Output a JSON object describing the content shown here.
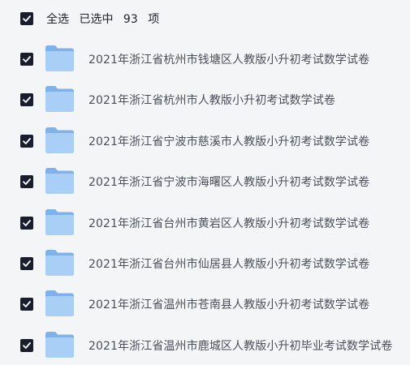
{
  "header": {
    "select_all": "全选",
    "selected_prefix": "已选中",
    "selected_count": "93",
    "selected_suffix": "项"
  },
  "files": [
    "2021年浙江省杭州市钱塘区人教版小升初考试数学试卷",
    "2021年浙江省杭州市人教版小升初考试数学试卷",
    "2021年浙江省宁波市慈溪市人教版小升初考试数学试卷",
    "2021年浙江省宁波市海曙区人教版小升初考试数学试卷",
    "2021年浙江省台州市黄岩区人教版小升初考试数学试卷",
    "2021年浙江省台州市仙居县人教版小升初考试数学试卷",
    "2021年浙江省温州市苍南县人教版小升初考试数学试卷",
    "2021年浙江省温州市鹿城区人教版小升初毕业考试数学试卷"
  ],
  "colors": {
    "checkbox": "#1a1d2e",
    "folder_back": "#7fb2ea",
    "folder_front": "#a9cff7",
    "background": "#f4f5f7"
  },
  "icons": {
    "checkbox": "checkmark-icon",
    "file": "folder-icon"
  }
}
